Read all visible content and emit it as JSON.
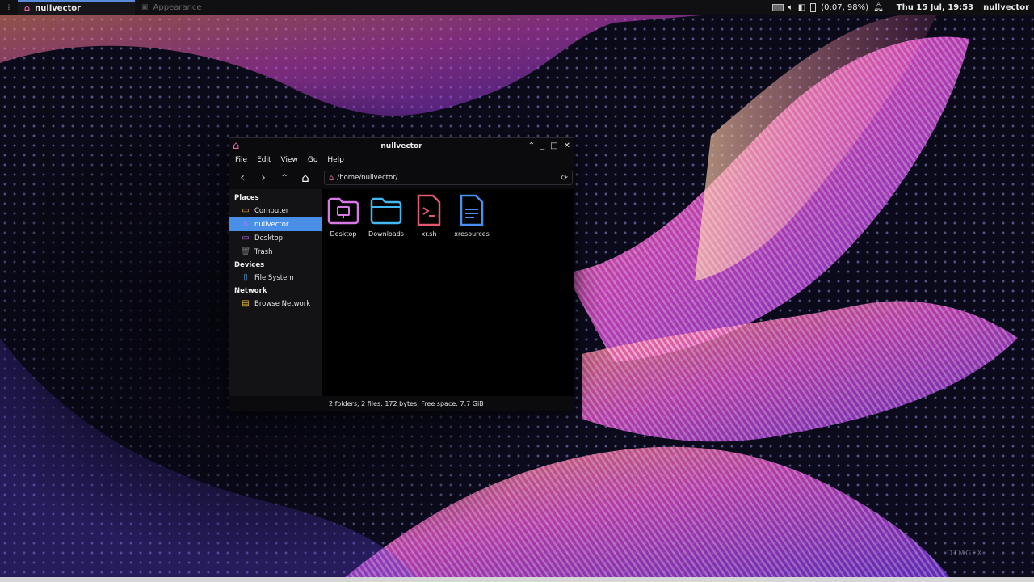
{
  "panel": {
    "active_task": "nullvector",
    "inactive_task": "Appearance",
    "battery": "(0:07, 98%)",
    "clock": "Thu 15 Jul, 19:53",
    "user": "nullvector"
  },
  "wallpaper": {
    "watermark": "DTMGFX"
  },
  "window": {
    "title": "nullvector",
    "menu": [
      "File",
      "Edit",
      "View",
      "Go",
      "Help"
    ],
    "location": "/home/nullvector/",
    "sidebar": {
      "places_header": "Places",
      "places": [
        {
          "label": "Computer",
          "icon": "computer-icon",
          "selected": false
        },
        {
          "label": "nullvector",
          "icon": "home-icon",
          "selected": true
        },
        {
          "label": "Desktop",
          "icon": "desktop-icon",
          "selected": false
        },
        {
          "label": "Trash",
          "icon": "trash-icon",
          "selected": false
        }
      ],
      "devices_header": "Devices",
      "devices": [
        {
          "label": "File System",
          "icon": "drive-icon"
        }
      ],
      "network_header": "Network",
      "network": [
        {
          "label": "Browse Network",
          "icon": "network-icon"
        }
      ]
    },
    "files": [
      {
        "name": "Desktop",
        "icon": "desktop-folder-icon",
        "color": "#d77ae6"
      },
      {
        "name": "Downloads",
        "icon": "folder-icon",
        "color": "#43b7f0"
      },
      {
        "name": "xr.sh",
        "icon": "script-file-icon",
        "color": "#e25a6c"
      },
      {
        "name": "xresources",
        "icon": "text-file-icon",
        "color": "#4b8ff2"
      }
    ],
    "status": "2 folders, 2 files: 172 bytes, Free space: 7.7 GiB"
  },
  "colors": {
    "accent": "#4a8fe7",
    "home_icon": "#e86aa8"
  }
}
